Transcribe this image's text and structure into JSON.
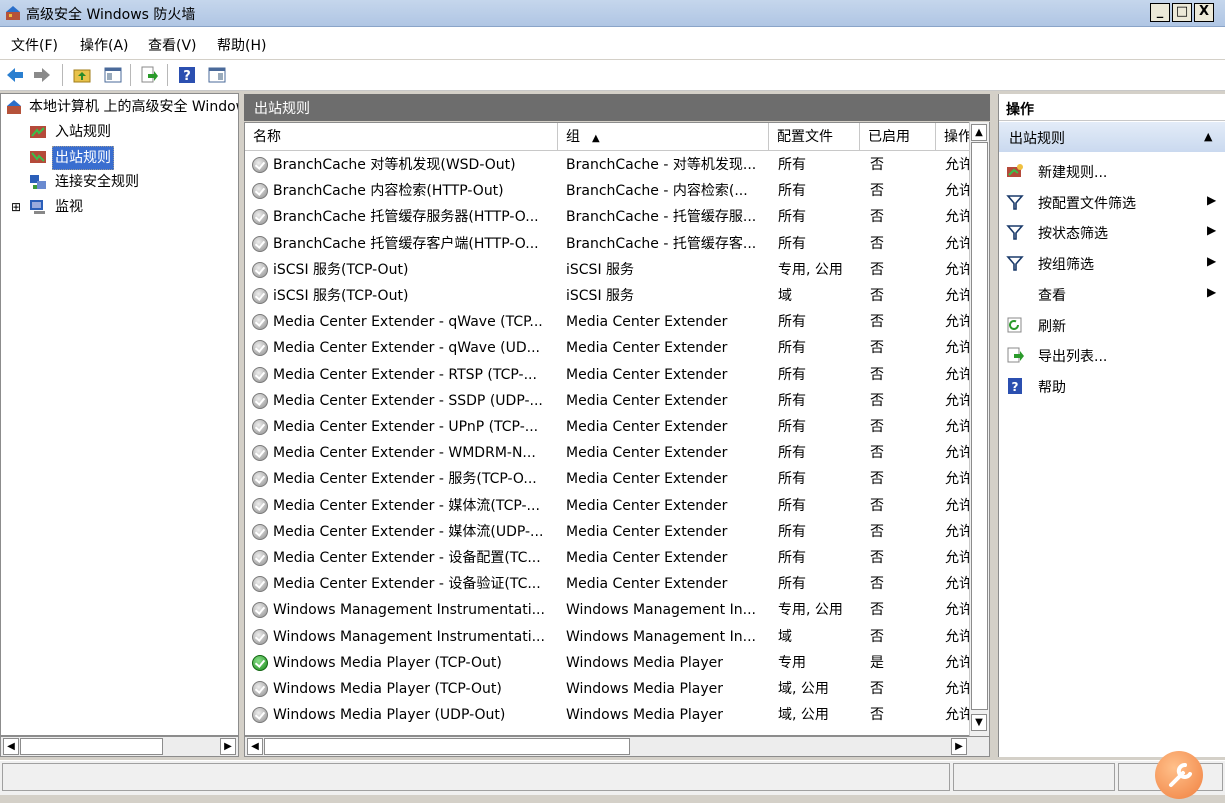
{
  "window": {
    "title": "高级安全 Windows 防火墙",
    "buttons": [
      "_",
      "□",
      "X"
    ]
  },
  "menubar": [
    "文件(F)",
    "操作(A)",
    "查看(V)",
    "帮助(H)"
  ],
  "toolbar": {
    "icons": [
      "back-arrow-icon",
      "forward-arrow-icon",
      "up-folder-icon",
      "show-hide-console-tree-icon",
      "export-list-icon",
      "help-icon",
      "show-hide-action-pane-icon"
    ]
  },
  "tree": {
    "root": "本地计算机 上的高级安全 Windows",
    "items": [
      {
        "label": "入站规则",
        "icon": "inbound-rules-icon"
      },
      {
        "label": "出站规则",
        "icon": "outbound-rules-icon",
        "selected": true
      },
      {
        "label": "连接安全规则",
        "icon": "connection-security-icon"
      },
      {
        "label": "监视",
        "icon": "monitor-icon",
        "expander": "⊞"
      }
    ]
  },
  "center": {
    "title": "出站规则",
    "columns": [
      "名称",
      "组",
      "配置文件",
      "已启用",
      "操作"
    ],
    "sort_indicator": "▲",
    "rows": [
      {
        "name": "BranchCache 对等机发现(WSD-Out)",
        "group": "BranchCache - 对等机发现...",
        "profile": "所有",
        "enabled": "否",
        "action": "允许"
      },
      {
        "name": "BranchCache 内容检索(HTTP-Out)",
        "group": "BranchCache - 内容检索(...",
        "profile": "所有",
        "enabled": "否",
        "action": "允许"
      },
      {
        "name": "BranchCache 托管缓存服务器(HTTP-O...",
        "group": "BranchCache - 托管缓存服...",
        "profile": "所有",
        "enabled": "否",
        "action": "允许"
      },
      {
        "name": "BranchCache 托管缓存客户端(HTTP-O...",
        "group": "BranchCache - 托管缓存客...",
        "profile": "所有",
        "enabled": "否",
        "action": "允许"
      },
      {
        "name": "iSCSI 服务(TCP-Out)",
        "group": "iSCSI 服务",
        "profile": "专用, 公用",
        "enabled": "否",
        "action": "允许"
      },
      {
        "name": "iSCSI 服务(TCP-Out)",
        "group": "iSCSI 服务",
        "profile": "域",
        "enabled": "否",
        "action": "允许"
      },
      {
        "name": "Media Center Extender - qWave (TCP...",
        "group": "Media Center Extender",
        "profile": "所有",
        "enabled": "否",
        "action": "允许"
      },
      {
        "name": "Media Center Extender - qWave (UD...",
        "group": "Media Center Extender",
        "profile": "所有",
        "enabled": "否",
        "action": "允许"
      },
      {
        "name": "Media Center Extender - RTSP (TCP-...",
        "group": "Media Center Extender",
        "profile": "所有",
        "enabled": "否",
        "action": "允许"
      },
      {
        "name": "Media Center Extender - SSDP (UDP-...",
        "group": "Media Center Extender",
        "profile": "所有",
        "enabled": "否",
        "action": "允许"
      },
      {
        "name": "Media Center Extender - UPnP (TCP-...",
        "group": "Media Center Extender",
        "profile": "所有",
        "enabled": "否",
        "action": "允许"
      },
      {
        "name": "Media Center Extender - WMDRM-N...",
        "group": "Media Center Extender",
        "profile": "所有",
        "enabled": "否",
        "action": "允许"
      },
      {
        "name": "Media Center Extender - 服务(TCP-O...",
        "group": "Media Center Extender",
        "profile": "所有",
        "enabled": "否",
        "action": "允许"
      },
      {
        "name": "Media Center Extender - 媒体流(TCP-...",
        "group": "Media Center Extender",
        "profile": "所有",
        "enabled": "否",
        "action": "允许"
      },
      {
        "name": "Media Center Extender - 媒体流(UDP-...",
        "group": "Media Center Extender",
        "profile": "所有",
        "enabled": "否",
        "action": "允许"
      },
      {
        "name": "Media Center Extender - 设备配置(TC...",
        "group": "Media Center Extender",
        "profile": "所有",
        "enabled": "否",
        "action": "允许"
      },
      {
        "name": "Media Center Extender - 设备验证(TC...",
        "group": "Media Center Extender",
        "profile": "所有",
        "enabled": "否",
        "action": "允许"
      },
      {
        "name": "Windows Management Instrumentati...",
        "group": "Windows Management In...",
        "profile": "专用, 公用",
        "enabled": "否",
        "action": "允许"
      },
      {
        "name": "Windows Management Instrumentati...",
        "group": "Windows Management In...",
        "profile": "域",
        "enabled": "否",
        "action": "允许"
      },
      {
        "name": "Windows Media Player (TCP-Out)",
        "group": "Windows Media Player",
        "profile": "专用",
        "enabled": "是",
        "action": "允许",
        "active": true
      },
      {
        "name": "Windows Media Player (TCP-Out)",
        "group": "Windows Media Player",
        "profile": "域, 公用",
        "enabled": "否",
        "action": "允许"
      },
      {
        "name": "Windows Media Player (UDP-Out)",
        "group": "Windows Media Player",
        "profile": "域, 公用",
        "enabled": "否",
        "action": "允许"
      }
    ]
  },
  "actions": {
    "header": "操作",
    "section": "出站规则",
    "section_arrow": "▲",
    "items": [
      {
        "label": "新建规则...",
        "icon": "new-rule-icon",
        "submenu": false
      },
      {
        "label": "按配置文件筛选",
        "icon": "filter-icon",
        "submenu": true
      },
      {
        "label": "按状态筛选",
        "icon": "filter-icon",
        "submenu": true
      },
      {
        "label": "按组筛选",
        "icon": "filter-icon",
        "submenu": true
      },
      {
        "label": "查看",
        "icon": "",
        "submenu": true
      },
      {
        "label": "刷新",
        "icon": "refresh-icon",
        "submenu": false
      },
      {
        "label": "导出列表...",
        "icon": "export-list-icon",
        "submenu": false
      },
      {
        "label": "帮助",
        "icon": "help-icon",
        "submenu": false
      }
    ]
  },
  "colors": {
    "selection": "#3a6ed0",
    "header_bar": "#6d6d6d",
    "enabled_icon": "#1a8a1a",
    "disabled_icon": "#8e8e8e"
  }
}
